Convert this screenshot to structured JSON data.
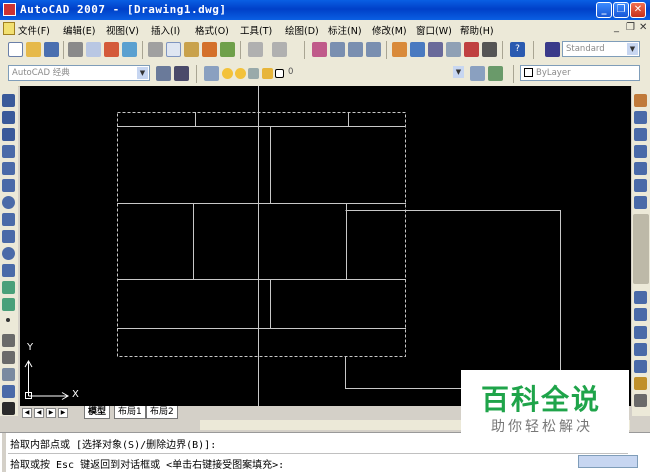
{
  "window": {
    "title": "AutoCAD 2007 - [Drawing1.dwg]"
  },
  "menu": [
    "文件(F)",
    "编辑(E)",
    "视图(V)",
    "插入(I)",
    "格式(O)",
    "工具(T)",
    "绘图(D)",
    "标注(N)",
    "修改(M)",
    "窗口(W)",
    "帮助(H)"
  ],
  "toolbar": {
    "workspace": "AutoCAD 经典",
    "text_style": "Standard",
    "layer": "0",
    "color": "ByLayer"
  },
  "canvas": {
    "ucs_y": "Y",
    "ucs_x": "X"
  },
  "tabs": [
    "模型",
    "布局1",
    "布局2"
  ],
  "command": {
    "line1": "拾取内部点或 [选择对象(S)/删除边界(B)]:",
    "line2": "拾取或按 Esc 键返回到对话框或 <单击右键接受图案填充>:"
  },
  "watermark": {
    "title": "百科全说",
    "subtitle": "助你轻松解决"
  },
  "colors": {
    "canvas": "#000000",
    "lines": "#c8c8c8",
    "titlebar": "#0a5fe3",
    "watermark_green": "#1fa44a"
  }
}
